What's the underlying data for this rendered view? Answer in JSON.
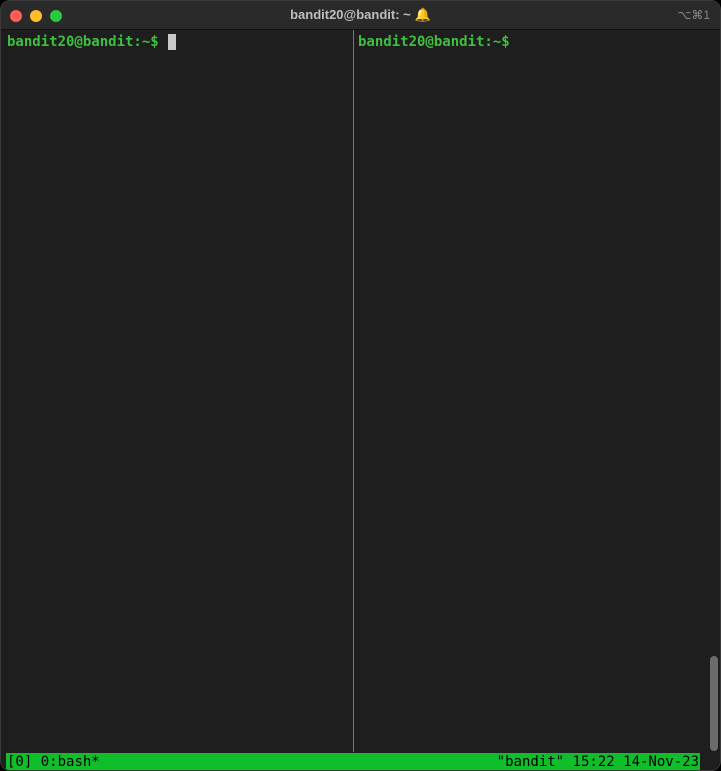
{
  "window": {
    "title": "bandit20@bandit: ~",
    "bell_icon": "🔔",
    "shortcut": "⌥⌘1"
  },
  "panes": {
    "left_prompt": "bandit20@bandit:~$",
    "right_prompt": "bandit20@bandit:~$"
  },
  "tmux_status": {
    "session": "[0]",
    "window": "0:bash*",
    "host": "\"bandit\"",
    "time": "15:22",
    "date": "14-Nov-23"
  },
  "colors": {
    "prompt": "#3fbf3f",
    "status_bar": "#0fbe2a",
    "divider": "#2fa82f",
    "background": "#1e1e1e"
  }
}
